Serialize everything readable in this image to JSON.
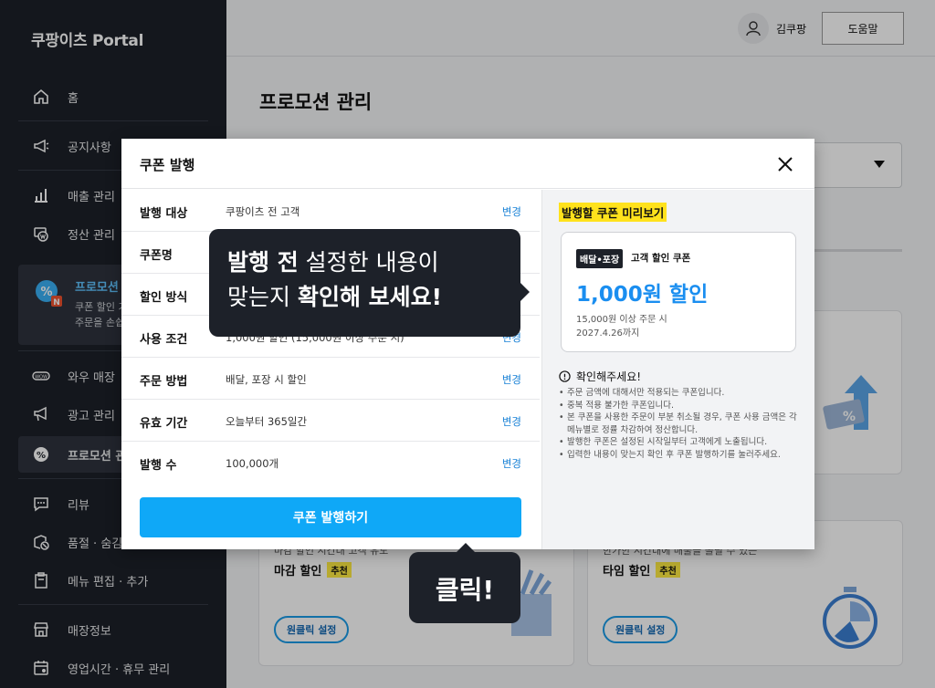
{
  "sidebar": {
    "brand": "쿠팡이츠 Portal",
    "items": [
      {
        "label": "홈",
        "icon": "home-icon"
      },
      {
        "label": "공지사항",
        "icon": "megaphone-icon"
      },
      {
        "label": "매출 관리",
        "icon": "bar-chart-icon"
      },
      {
        "label": "정산 관리",
        "icon": "won-coin-icon"
      },
      {
        "label": "와우 매장",
        "icon": "wow-icon"
      },
      {
        "label": "광고 관리",
        "icon": "ad-megaphone-icon"
      },
      {
        "label": "프로모션 관",
        "icon": "percent-badge-icon"
      },
      {
        "label": "리뷰",
        "icon": "chat-icon"
      },
      {
        "label": "품절 · 숨김",
        "icon": "stock-icon"
      },
      {
        "label": "메뉴 편집 · 추가",
        "icon": "menu-edit-icon"
      },
      {
        "label": "매장정보",
        "icon": "store-icon"
      },
      {
        "label": "영업시간 · 휴무 관리",
        "icon": "calendar-icon"
      }
    ],
    "promo_block": {
      "title": "프로모션",
      "desc_line1": "쿠폰 할인 기",
      "desc_line2": "주문을 손쉽"
    }
  },
  "topbar": {
    "user_name": "김쿠팡",
    "help_label": "도움말"
  },
  "main": {
    "page_title": "프로모션 관리",
    "cards": [
      {
        "caption": "마감 할인 시간대 고객 유도",
        "title": "마감 할인",
        "badge": "추천",
        "button": "원클릭 설정"
      },
      {
        "caption": "한가한 시간대에 매출을 올릴 수 있는",
        "title": "타임 할인",
        "badge": "추천",
        "button": "원클릭 설정"
      }
    ]
  },
  "modal": {
    "title": "쿠폰 발행",
    "rows": [
      {
        "label": "발행 대상",
        "value": "쿠팡이츠 전 고객",
        "change": "변경"
      },
      {
        "label": "쿠폰명",
        "value": "",
        "change": ""
      },
      {
        "label": "할인 방식",
        "value": "",
        "change": ""
      },
      {
        "label": "사용 조건",
        "value": "1,000원 할인 (15,000원 이상 주문 시)",
        "change": "변경"
      },
      {
        "label": "주문 방법",
        "value": "배달, 포장 시 할인",
        "change": "변경"
      },
      {
        "label": "유효 기간",
        "value": "오늘부터 365일간",
        "change": "변경"
      },
      {
        "label": "발행 수",
        "value": "100,000개",
        "change": "변경"
      }
    ],
    "issue_button": "쿠폰 발행하기",
    "preview": {
      "title": "발행할 쿠폰 미리보기",
      "tag": "배달•포장",
      "type": "고객 할인 쿠폰",
      "amount": "1,000원 할인",
      "condition": "15,000원 이상 주문 시",
      "expiry": "2027.4.26까지",
      "notice_title": "확인해주세요!",
      "notices": [
        "주문 금액에 대해서만 적용되는 쿠폰입니다.",
        "중복 적용 불가한 쿠폰입니다.",
        "본 쿠폰을 사용한 주문이 부분 취소될 경우, 쿠폰 사용 금액은 각 메뉴별로 정률 차감하여 정산합니다.",
        "발행한 쿠폰은 설정된 시작일부터 고객에게 노출됩니다.",
        "입력한 내용이 맞는지 확인 후 쿠폰 발행하기를 눌러주세요."
      ]
    }
  },
  "tooltips": {
    "check_line1_bold": "발행 전",
    "check_line1_rest": " 설정한 내용이",
    "check_line2_pre": "맞는지 ",
    "check_line2_bold": "확인해 보세요!",
    "click": "클릭!"
  },
  "colors": {
    "accent": "#0fa8f7",
    "sidebar_bg": "#1d2129",
    "highlight": "#ffe21c"
  }
}
